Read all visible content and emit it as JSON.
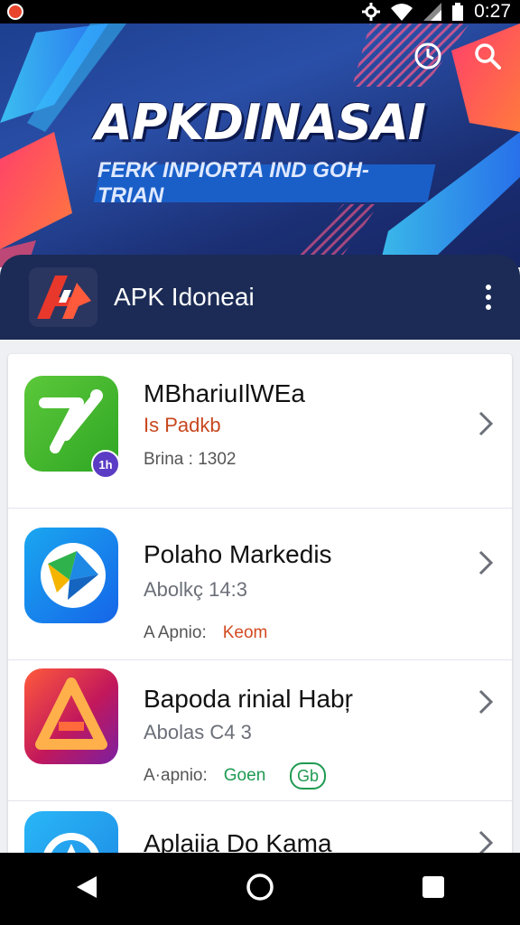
{
  "status_bar": {
    "time": "0:27",
    "icons": [
      "notification-icon",
      "settings-icon",
      "wifi-icon",
      "signal-icon",
      "battery-icon"
    ]
  },
  "header": {
    "hero_title": "APKDINASAI",
    "hero_subtitle": "FERK INPIORTA IND GOH-TRIAN",
    "icons": [
      "history-icon",
      "search-icon"
    ]
  },
  "app_bar": {
    "title": "APK Idoneai",
    "logo_text": "A",
    "menu_icon": "more-vert-icon"
  },
  "apps": [
    {
      "title": "MBhariuIlWEa",
      "subtitle": "Is Padkb",
      "subtitle_color": "#c8471e",
      "meta": "Brina : 1302",
      "tag": "",
      "tag_color": "",
      "badge": "1h",
      "icon": "green-arrow-icon"
    },
    {
      "title": "Polaho Markedis",
      "subtitle": "Abolkç 14:3",
      "subtitle_color": "#6b6f78",
      "meta": "A Apnio:",
      "tag": "Keom",
      "tag_color": "#d24a1f",
      "badge": "",
      "icon": "play-triangle-icon"
    },
    {
      "title": "Bapoda rinial Habŗ",
      "subtitle": "Abolas C4 3",
      "subtitle_color": "#6b6f78",
      "meta": "A·apnio:",
      "tag": "Goen",
      "tag_color": "#1f9a52",
      "badge": "Gb",
      "icon": "triangle-a-icon"
    },
    {
      "title": "Aplaiia Do Kama",
      "subtitle": "",
      "subtitle_color": "#6b6f78",
      "meta": "",
      "tag": "",
      "tag_color": "",
      "badge": "",
      "icon": "blue-arrow-icon"
    }
  ],
  "nav": {
    "back": "back-icon",
    "home": "home-icon",
    "recents": "recents-icon"
  }
}
